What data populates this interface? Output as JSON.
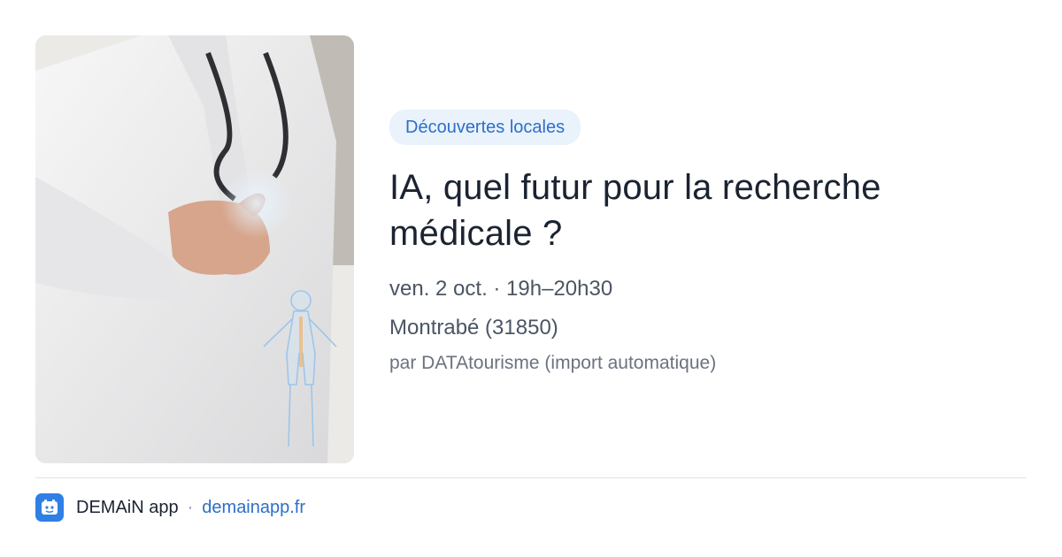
{
  "card": {
    "image_subject": "doctor-hologram-image",
    "category_badge": "Découvertes locales",
    "title": "IA, quel futur pour la recherche médicale ?",
    "date_time": "ven. 2 oct. · 19h–20h30",
    "location": "Montrabé (31850)",
    "source": "par DATAtourisme (import automatique)"
  },
  "footer": {
    "app_name": "DEMAiN app",
    "separator": "·",
    "app_url": "demainapp.fr",
    "app_icon": "demain-logo-icon"
  },
  "colors": {
    "accent": "#2d6fc8",
    "badge_bg": "#eaf2fc",
    "title": "#1b2331",
    "meta": "#4b5563",
    "muted": "#6b7280",
    "app_icon_bg": "#2f7fe6"
  }
}
